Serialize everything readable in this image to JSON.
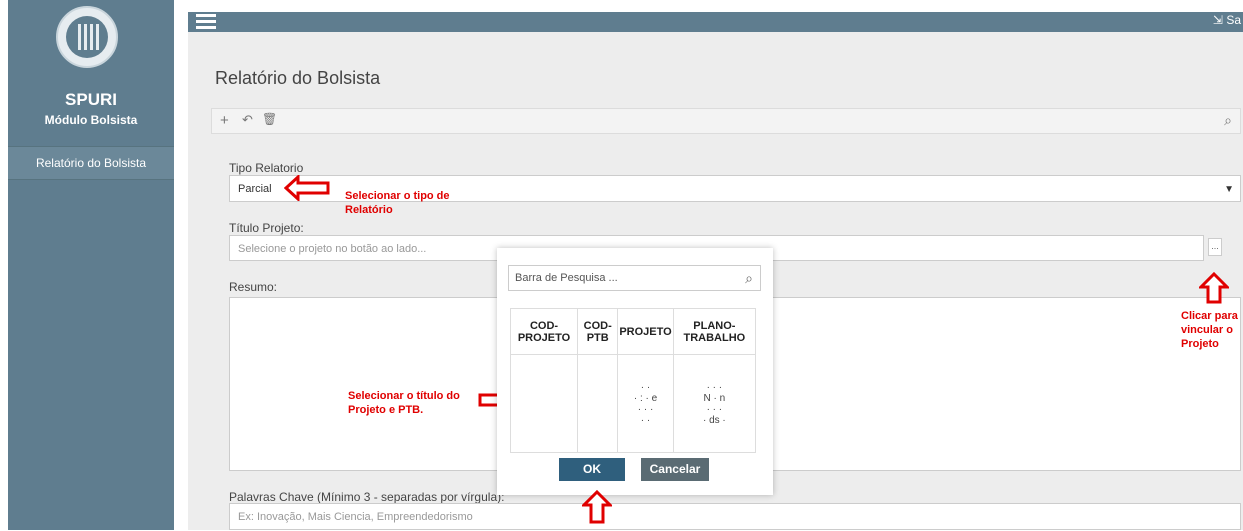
{
  "app": {
    "name": "SPURI",
    "module": "Módulo Bolsista",
    "exit_label": "Sa"
  },
  "sidebar": {
    "items": [
      {
        "label": "Relatório do Bolsista"
      }
    ]
  },
  "page": {
    "title": "Relatório do Bolsista"
  },
  "toolbar": {
    "add_icon": "+",
    "undo_icon": "↶",
    "delete_icon": "🗑",
    "search_icon": "⌕"
  },
  "form": {
    "tipo_label": "Tipo Relatorio",
    "tipo_value": "Parcial",
    "titulo_label": "Título Projeto:",
    "titulo_placeholder": "Selecione o projeto no botão ao lado...",
    "browse_label": "...",
    "resumo_label": "Resumo:",
    "palavras_label": "Palavras Chave (Mínimo 3 - separadas por vírgula):",
    "palavras_placeholder": "Ex: Inovação, Mais Ciencia, Empreendedorismo"
  },
  "annotations": {
    "tipo": "Selecionar o tipo de Relatório",
    "projeto": "Clicar para vincular o Projeto",
    "titulo": "Selecionar o título do Projeto e PTB."
  },
  "modal": {
    "search_placeholder": "Barra de Pesquisa ...",
    "columns": [
      "COD-PROJETO",
      "COD-PTB",
      "PROJETO",
      "PLANO-TRABALHO"
    ],
    "ok_label": "OK",
    "cancel_label": "Cancelar"
  },
  "colors": {
    "sidebar": "#5f7d8f",
    "annotation": "#e00000",
    "ok_button": "#2f5f7d"
  }
}
